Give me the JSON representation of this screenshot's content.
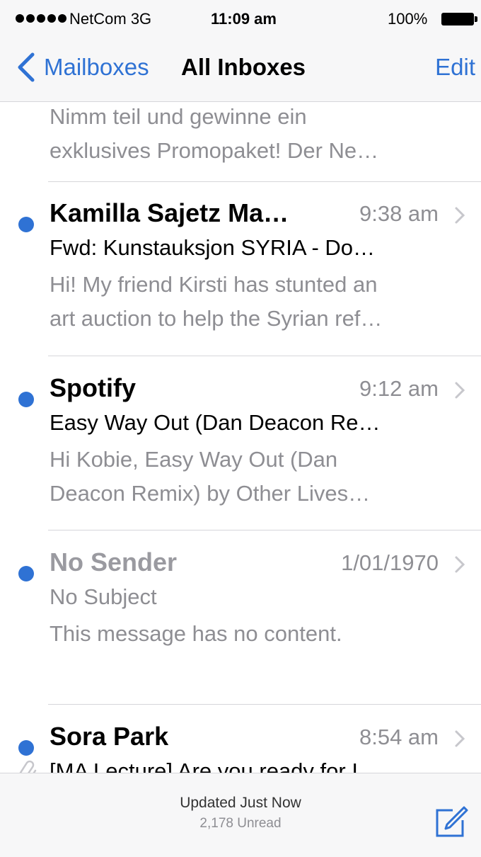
{
  "status_bar": {
    "carrier": "NetCom",
    "network": "3G",
    "time": "11:09 am",
    "battery": "100%",
    "signal_bars": 5
  },
  "nav": {
    "back_label": "Mailboxes",
    "title": "All Inboxes",
    "edit_label": "Edit"
  },
  "partial_message": {
    "preview_line1": "Nimm teil und gewinne ein",
    "preview_line2": "exklusives Promopaket! Der Ne…"
  },
  "messages": [
    {
      "sender": "Kamilla Sajetz Ma…",
      "time": "9:38 am",
      "subject": "Fwd: Kunstauksjon SYRIA - Do…",
      "preview_line1": "Hi! My friend Kirsti has stunted an",
      "preview_line2": "art auction to help the Syrian ref…",
      "unread": true
    },
    {
      "sender": "Spotify",
      "time": "9:12 am",
      "subject": "Easy Way Out (Dan Deacon Re…",
      "preview_line1": "Hi Kobie, Easy Way Out (Dan",
      "preview_line2": "Deacon Remix) by Other Lives…",
      "unread": true
    },
    {
      "sender": "No Sender",
      "time": "1/01/1970",
      "subject": "No Subject",
      "preview_line1": "This message has no content.",
      "preview_line2": "",
      "unread": true
    },
    {
      "sender": "Sora Park",
      "time": "8:54 am",
      "subject": "[MA Lecture] Are you ready for I…",
      "preview_line1": "",
      "preview_line2": "",
      "unread": true,
      "attachment": true
    }
  ],
  "toolbar": {
    "updated": "Updated Just Now",
    "unread_count": "2,178 Unread"
  },
  "colors": {
    "accent": "#2f72d4",
    "secondary_text": "#8e8e93",
    "bar_background": "#f7f7f8"
  },
  "icons": [
    "back-chevron-icon",
    "disclosure-chevron-icon",
    "paperclip-icon",
    "compose-icon"
  ]
}
